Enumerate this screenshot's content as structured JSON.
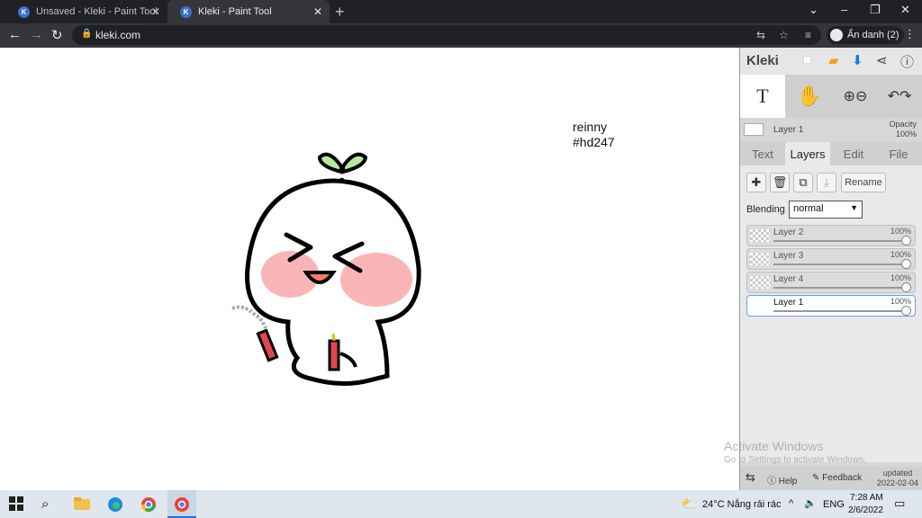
{
  "browser": {
    "tabs": [
      {
        "title": "Unsaved - Kleki - Paint Tool",
        "active": false
      },
      {
        "title": "Kleki - Paint Tool",
        "active": true
      }
    ],
    "new_tab_label": "+",
    "url": "kleki.com",
    "profile_label": "Ẩn danh (2)",
    "window_controls": [
      "⌄",
      "–",
      "❐",
      "✕"
    ]
  },
  "canvas": {
    "text_line1": "reinny",
    "text_line2": "#hd247"
  },
  "panel": {
    "brand": "Kleki",
    "layer_header": {
      "name": "Layer 1",
      "opacity_label": "Opacity",
      "opacity_value": "100%"
    },
    "tabs": [
      "Text",
      "Layers",
      "Edit",
      "File"
    ],
    "active_tab": "Layers",
    "rename_label": "Rename",
    "blending_label": "Blending",
    "blending_value": "normal",
    "layers": [
      {
        "name": "Layer 2",
        "opacity": "100%"
      },
      {
        "name": "Layer 3",
        "opacity": "100%"
      },
      {
        "name": "Layer 4",
        "opacity": "100%"
      },
      {
        "name": "Layer 1",
        "opacity": "100%"
      }
    ],
    "footer": {
      "help": "Help",
      "feedback": "Feedback",
      "updated_label": "updated",
      "updated_date": "2022-02-04"
    }
  },
  "watermark": {
    "line1": "Activate Windows",
    "line2": "Go to Settings to activate Windows."
  },
  "taskbar": {
    "weather": "24°C  Nắng rải rác",
    "language": "ENG",
    "time": "7:28 AM",
    "date": "2/6/2022"
  },
  "colors": {
    "chrome_dark": "#202124",
    "chrome_toolbar": "#35363a",
    "panel_bg": "#d7d7d7",
    "accent_blue": "#1a73e8",
    "blush": "#f7a3a3",
    "sprout": "#b9e6a0",
    "firecracker": "#e2474f"
  }
}
